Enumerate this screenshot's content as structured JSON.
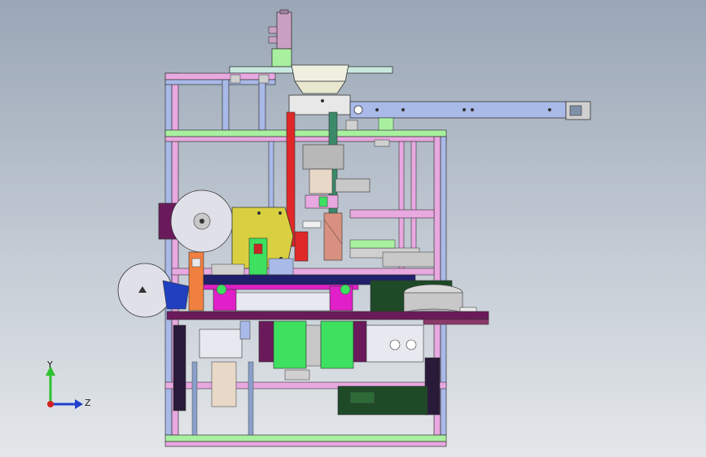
{
  "viewport": {
    "background_top": "#9aa6b6",
    "background_bottom": "#e4e7ea",
    "model_colors": {
      "frame_blue": "#a9b9e8",
      "frame_green": "#a8f0a0",
      "frame_pink": "#e8a8e0",
      "magenta": "#e020c8",
      "yellow": "#d8d040",
      "red": "#e02828",
      "orange": "#f08040",
      "dark_green": "#1f4a28",
      "bright_green": "#3ee060",
      "gray_part": "#c8c8c8",
      "purple_dark": "#6a1a5a"
    }
  },
  "triad": {
    "y_label": "Y",
    "z_label": "Z",
    "y_color": "#2ec12e",
    "z_color": "#2040d0",
    "x_color": "#d02020"
  }
}
